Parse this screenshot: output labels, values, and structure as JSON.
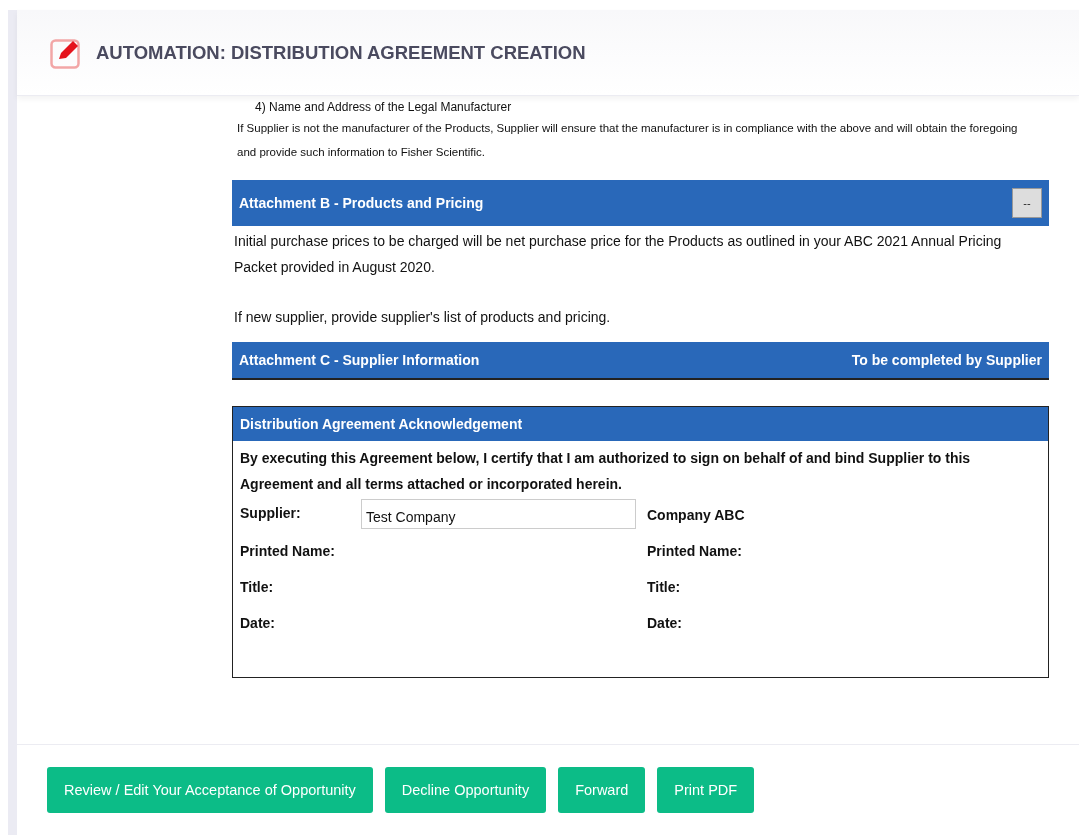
{
  "header": {
    "title": "AUTOMATION: DISTRIBUTION AGREEMENT CREATION"
  },
  "intro": {
    "list_item": "4) Name and Address of the Legal Manufacturer",
    "paragraph": "If Supplier is not the manufacturer of the Products, Supplier will ensure that the manufacturer is in compliance with the above and will obtain the foregoing and provide such information to Fisher Scientific."
  },
  "sections": [
    {
      "title": "Attachment B - Products and Pricing",
      "collapse_button": "--",
      "paragraphs": [
        "Initial purchase prices to be charged will be net purchase price for the Products as outlined in your ABC 2021 Annual Pricing Packet provided in August 2020.",
        "If new supplier, provide supplier's list of products and pricing."
      ]
    },
    {
      "title": "Attachment C - Supplier Information",
      "note": "To be completed by Supplier"
    }
  ],
  "acknowledgement": {
    "title": "Distribution Agreement Acknowledgement",
    "statement": "By executing this Agreement below, I certify that I am authorized to sign on behalf of and bind Supplier to this Agreement and all terms attached or incorporated herein.",
    "supplier": {
      "label": "Supplier:",
      "value": "Test Company"
    },
    "company": "Company ABC",
    "left_fields": [
      "Printed Name:",
      "Title:",
      "Date:"
    ],
    "right_fields": [
      "Printed Name:",
      "Title:",
      "Date:"
    ]
  },
  "buttons": [
    "Review / Edit Your Acceptance of Opportunity",
    "Decline Opportunity",
    "Forward",
    "Print PDF"
  ]
}
